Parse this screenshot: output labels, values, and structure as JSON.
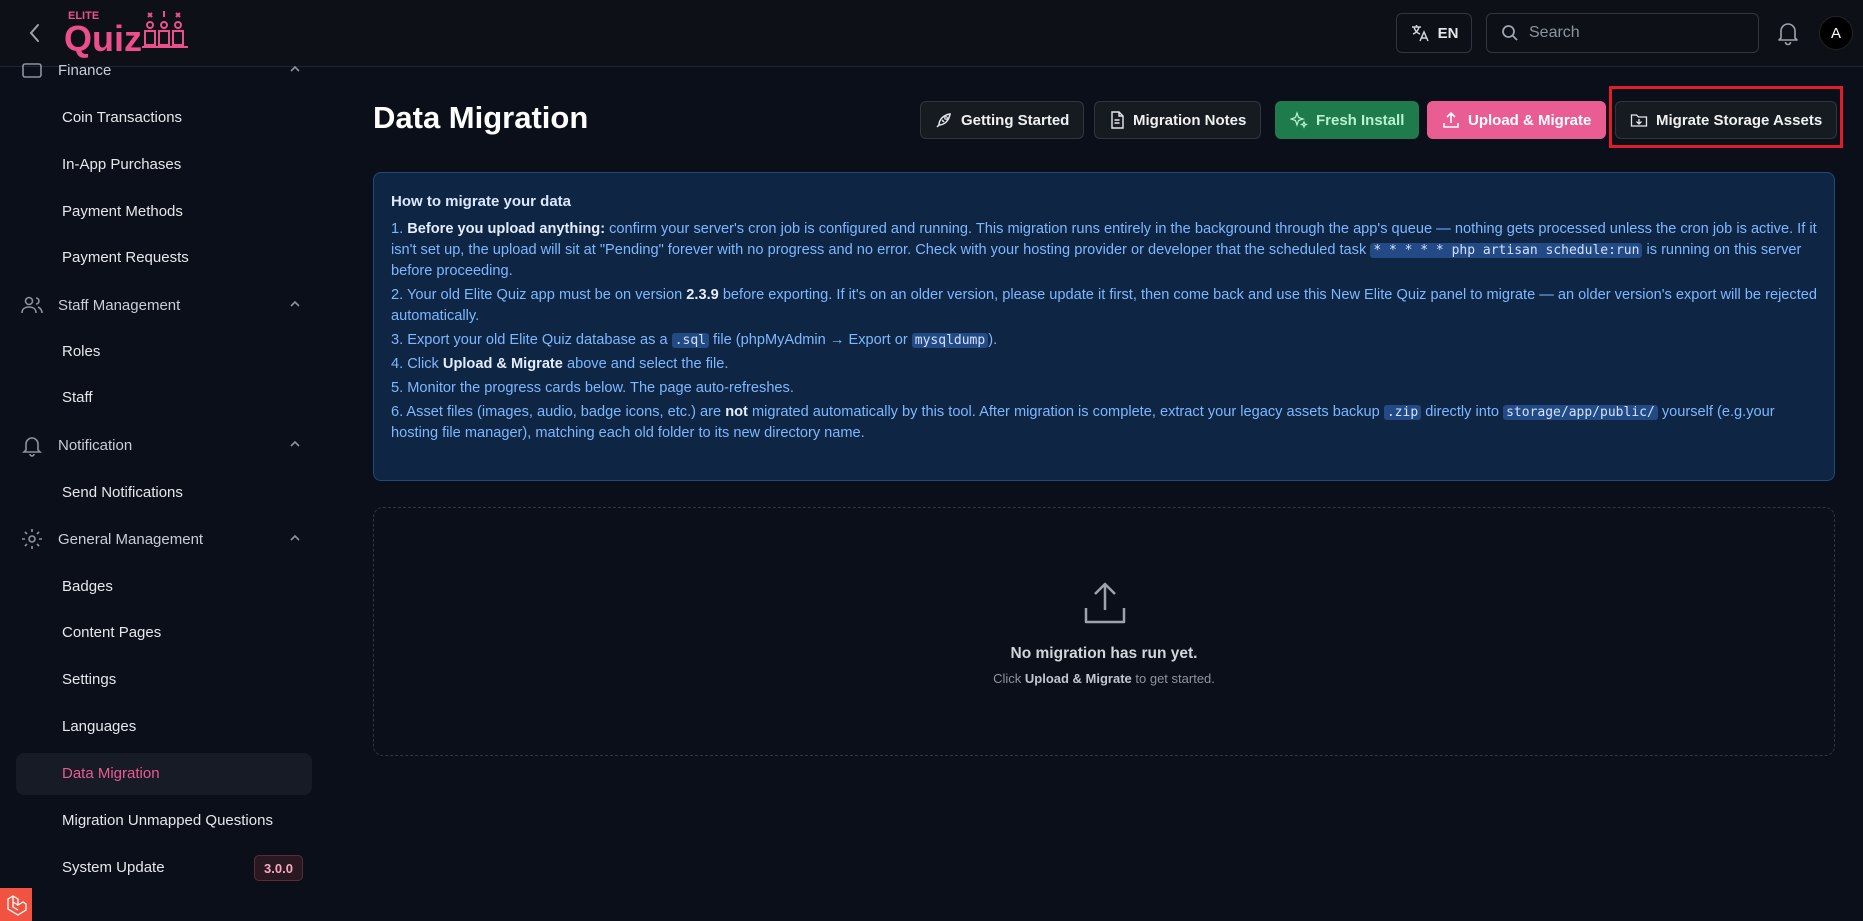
{
  "header": {
    "logo_top": "ELITE",
    "logo_main": "Quiz",
    "language": "EN",
    "search_placeholder": "Search",
    "avatar_initial": "A"
  },
  "sidebar": {
    "groups": {
      "finance": "Finance",
      "staff": "Staff Management",
      "notification": "Notification",
      "general": "General Management"
    },
    "items": {
      "coin_transactions": "Coin Transactions",
      "in_app_purchases": "In-App Purchases",
      "payment_methods": "Payment Methods",
      "payment_requests": "Payment Requests",
      "roles": "Roles",
      "staff": "Staff",
      "send_notifications": "Send Notifications",
      "badges": "Badges",
      "content_pages": "Content Pages",
      "settings": "Settings",
      "languages": "Languages",
      "data_migration": "Data Migration",
      "migration_unmapped": "Migration Unmapped Questions",
      "system_update": "System Update"
    },
    "version_badge": "3.0.0"
  },
  "main": {
    "title": "Data Migration",
    "buttons": {
      "getting_started": "Getting Started",
      "migration_notes": "Migration Notes",
      "fresh_install": "Fresh Install",
      "upload_migrate": "Upload & Migrate",
      "migrate_storage": "Migrate Storage Assets"
    },
    "info": {
      "heading": "How to migrate your data",
      "s1_num": "1.",
      "s1_bold": "Before you upload anything:",
      "s1_text": " confirm your server's cron job is configured and running. This migration runs entirely in the background through the app's queue — nothing gets processed unless the cron job is active. If it isn't set up, the upload will sit at \"Pending\" forever with no progress and no error. Check with your hosting provider or developer that the scheduled task ",
      "s1_code": "* * * * * php artisan schedule:run",
      "s1_tail": " is running on this server before proceeding.",
      "s2_a": "2. Your old Elite Quiz app must be on version ",
      "s2_bold": "2.3.9",
      "s2_b": " before exporting. If it's on an older version, please update it first, then come back and use this New Elite Quiz panel to migrate — an older version's export will be rejected automatically.",
      "s3_a": "3. Export your old Elite Quiz database as a ",
      "s3_code1": ".sql",
      "s3_b": " file (phpMyAdmin → Export or ",
      "s3_code2": "mysqldump",
      "s3_c": ").",
      "s4_a": "4. Click ",
      "s4_bold": "Upload & Migrate",
      "s4_b": " above and select the file.",
      "s5": "5. Monitor the progress cards below. The page auto-refreshes.",
      "s6_a": "6. Asset files (images, audio, badge icons, etc.) are ",
      "s6_bold": "not",
      "s6_b": " migrated automatically by this tool. After migration is complete, extract your legacy assets backup ",
      "s6_code1": ".zip",
      "s6_c": " directly into ",
      "s6_code2": "storage/app/public/",
      "s6_d": " yourself (e.g.your hosting file manager), matching each old folder to its new directory name."
    },
    "empty": {
      "title": "No migration has run yet.",
      "sub_a": "Click ",
      "sub_bold": "Upload & Migrate",
      "sub_b": " to get started."
    }
  },
  "colors": {
    "accent_pink": "#ea5d92",
    "green": "#1f7a4c",
    "highlight_red": "#e11d2a",
    "info_bg": "#0f2544"
  }
}
